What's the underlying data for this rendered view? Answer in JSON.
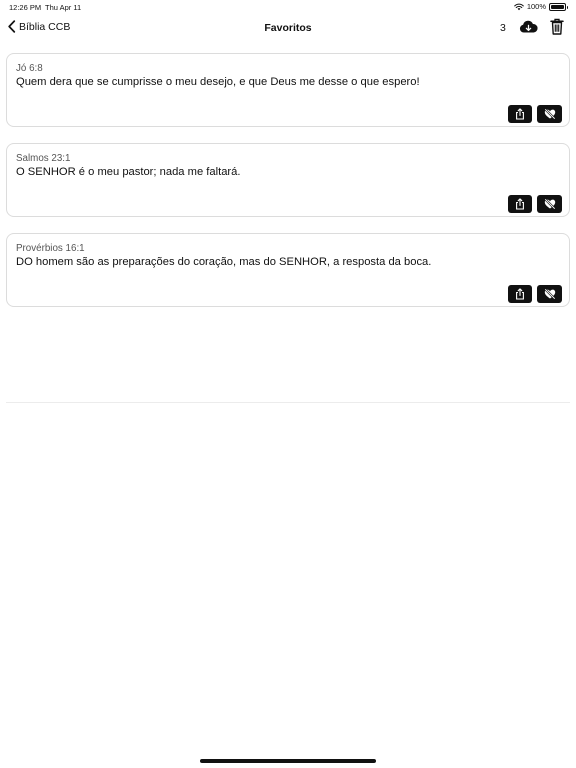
{
  "status_bar": {
    "time": "12:26 PM",
    "date": "Thu Apr 11",
    "battery": "100%"
  },
  "nav": {
    "back_label": "Bíblia CCB",
    "title": "Favoritos",
    "count": "3"
  },
  "favorites": [
    {
      "ref": "Jó 6:8",
      "text": "Quem dera que se cumprisse o meu desejo, e que Deus me desse o que espero!"
    },
    {
      "ref": "Salmos 23:1",
      "text": "O SENHOR é o meu pastor; nada me faltará."
    },
    {
      "ref": "Provérbios 16:1",
      "text": "DO homem são as preparações do coração, mas do SENHOR, a resposta da boca."
    }
  ],
  "icons": {
    "back": "chevron-left-icon",
    "cloud": "cloud-download-icon",
    "trash": "trash-icon",
    "share": "share-icon",
    "unfavorite": "heart-slash-icon"
  }
}
